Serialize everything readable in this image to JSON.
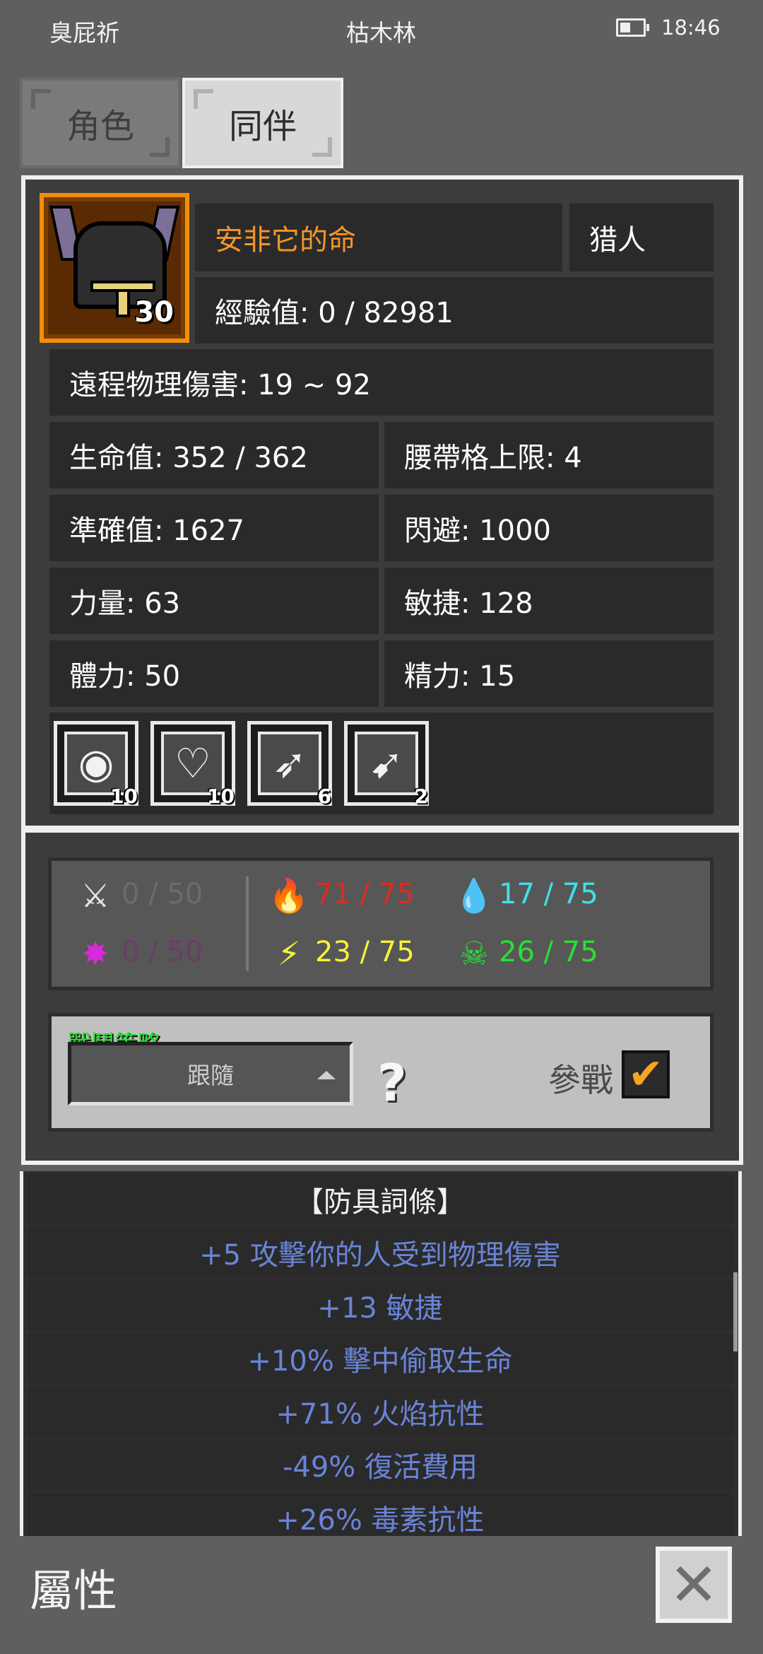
{
  "status_bar": {
    "left_text": "臭屁祈",
    "center_text": "枯木林",
    "time": "18:46"
  },
  "tabs": [
    {
      "label": "角色"
    },
    {
      "label": "同伴"
    }
  ],
  "companion": {
    "name": "安非它的命",
    "class": "猎人",
    "level": "30",
    "experience": "經驗值: 0 / 82981",
    "damage": "遠程物理傷害: 19 ~ 92",
    "stats": {
      "hp": "生命值: 352 / 362",
      "belt": "腰帶格上限: 4",
      "accuracy": "準確值: 1627",
      "dodge": "閃避: 1000",
      "strength": "力量: 63",
      "agility": "敏捷: 128",
      "stamina": "體力: 50",
      "spirit": "精力: 15"
    },
    "skills": [
      {
        "icon": "shield-eye-icon",
        "count": "10"
      },
      {
        "icon": "heart-shield-icon",
        "count": "10"
      },
      {
        "icon": "arrow-volley-icon",
        "count": "6"
      },
      {
        "icon": "arrow-shot-icon",
        "count": "2"
      }
    ]
  },
  "resistances": {
    "physical": "0 / 50",
    "magic": "0 / 50",
    "fire": "71 / 75",
    "lightning": "23 / 75",
    "cold": "17 / 75",
    "poison": "26 / 75",
    "colors": {
      "physical": "#6b6b6b",
      "magic": "#6a3d6a",
      "fire": "#e02a1f",
      "lightning": "#f6f23a",
      "cold": "#3fe0e8",
      "poison": "#29e035"
    }
  },
  "strategy": {
    "label": "戰鬥策略",
    "selected": "跟隨",
    "help_icon": "?",
    "join_label": "參戰",
    "join_checked": true
  },
  "affixes": {
    "header": "【防具詞條】",
    "items": [
      "+5 攻擊你的人受到物理傷害",
      "+13 敏捷",
      "+10% 擊中偷取生命",
      "+71% 火焰抗性",
      "-49% 復活費用",
      "+26% 毒素抗性"
    ]
  },
  "footer": {
    "title": "屬性",
    "close_icon": "✕"
  }
}
